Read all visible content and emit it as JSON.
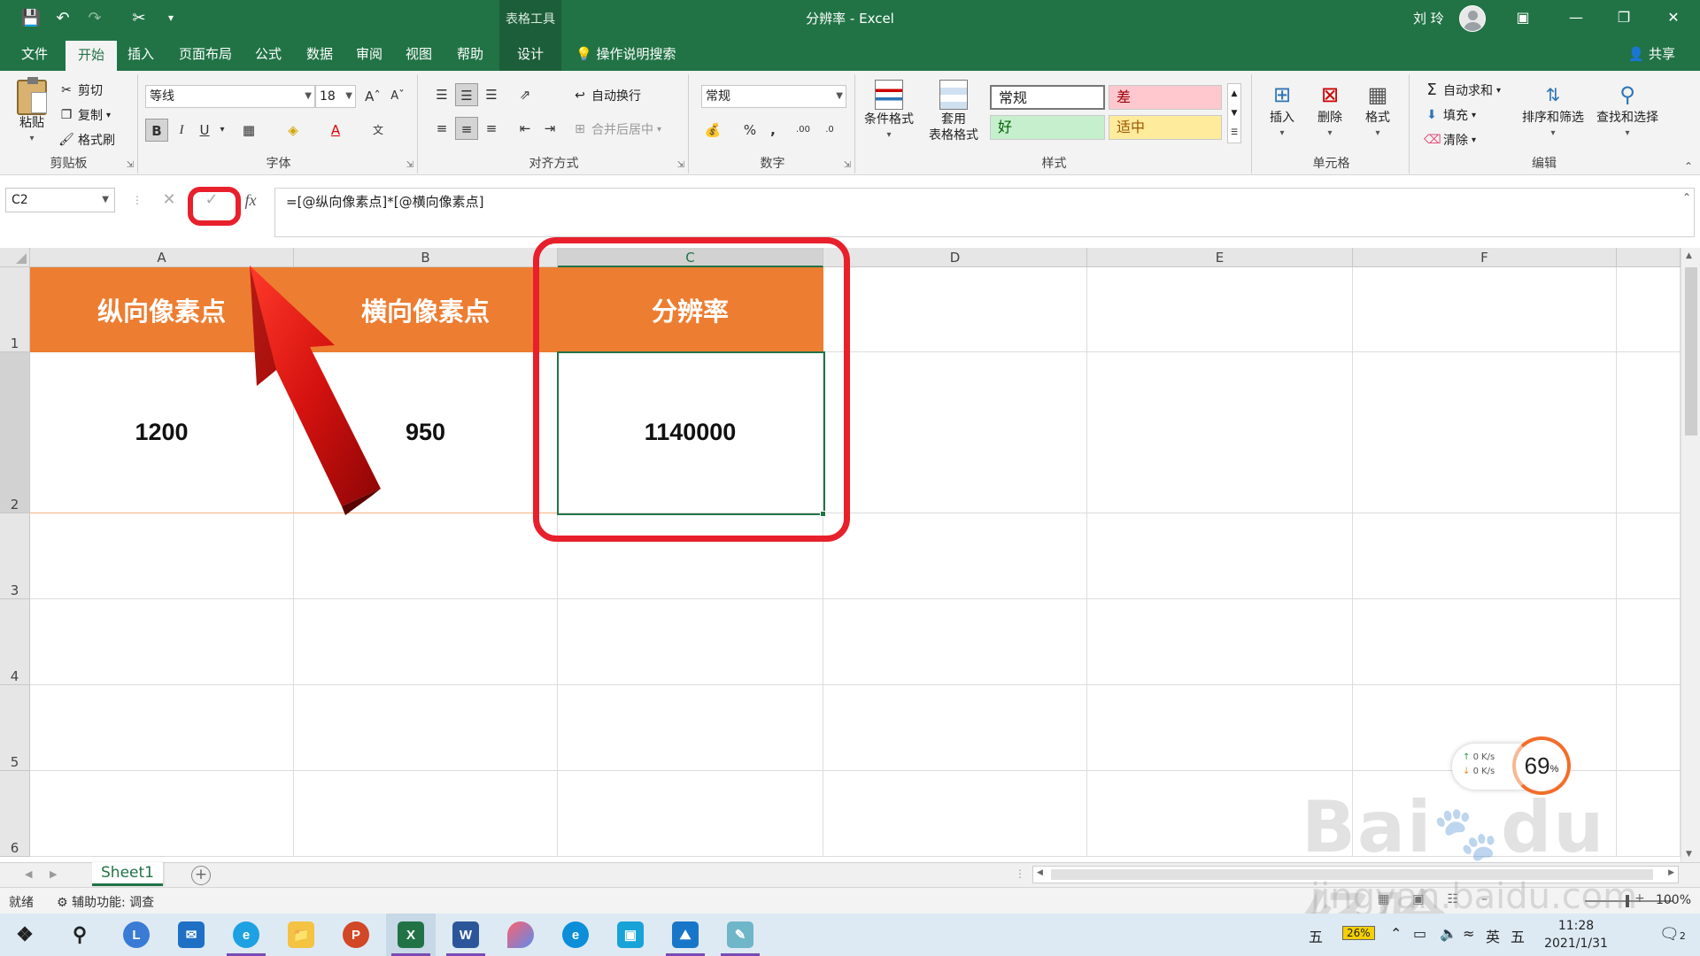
{
  "titlebar": {
    "context_tools": "表格工具",
    "doc_title": "分辨率 - Excel",
    "user_name": "刘 玲"
  },
  "tabs": [
    "文件",
    "开始",
    "插入",
    "页面布局",
    "公式",
    "数据",
    "审阅",
    "视图",
    "帮助",
    "设计"
  ],
  "tell_me": "操作说明搜索",
  "share": "共享",
  "ribbon": {
    "clipboard": {
      "paste": "粘贴",
      "cut": "剪切",
      "copy": "复制",
      "format_painter": "格式刷",
      "label": "剪贴板"
    },
    "font": {
      "name": "等线",
      "size": "18",
      "label": "字体"
    },
    "alignment": {
      "wrap_text": "自动换行",
      "merge_center": "合并后居中",
      "label": "对齐方式"
    },
    "number": {
      "format": "常规",
      "label": "数字"
    },
    "styles": {
      "conditional": "条件格式",
      "table_fmt_line1": "套用",
      "table_fmt_line2": "表格格式",
      "normal": "常规",
      "bad": "差",
      "good": "好",
      "neutral": "适中",
      "label": "样式"
    },
    "cells": {
      "insert": "插入",
      "delete": "删除",
      "format": "格式",
      "label": "单元格"
    },
    "editing": {
      "autosum": "自动求和",
      "fill": "填充",
      "clear": "清除",
      "sort_filter": "排序和筛选",
      "find_select": "查找和选择",
      "label": "编辑"
    }
  },
  "formula_bar": {
    "name_box": "C2",
    "fx": "fx",
    "formula": "=[@纵向像素点]*[@横向像素点]"
  },
  "columns": [
    "A",
    "B",
    "C",
    "D",
    "E",
    "F"
  ],
  "rows": [
    "1",
    "2",
    "3",
    "4",
    "5",
    "6"
  ],
  "table": {
    "headers": [
      "纵向像素点",
      "横向像素点",
      "分辨率"
    ],
    "values": [
      "1200",
      "950",
      "1140000"
    ]
  },
  "sheet_tab": "Sheet1",
  "status": {
    "ready": "就绪",
    "accessibility": "辅助功能: 调查",
    "zoom": "100%"
  },
  "speed_widget": {
    "up": "0  K/s",
    "down": "0  K/s",
    "percent": "69",
    "unit": "%"
  },
  "taskbar": {
    "ime1": "五",
    "battery": "26%",
    "lang": "英",
    "ime2": "五",
    "time": "11:28",
    "date": "2021/1/31",
    "notif_count": "2"
  },
  "watermark": {
    "main": "Bai du 经验",
    "sub": "jingyan.baidu.com"
  },
  "colors": {
    "excel_green": "#217346",
    "header_orange": "#ED7D31",
    "annotation_red": "#E8202C"
  }
}
